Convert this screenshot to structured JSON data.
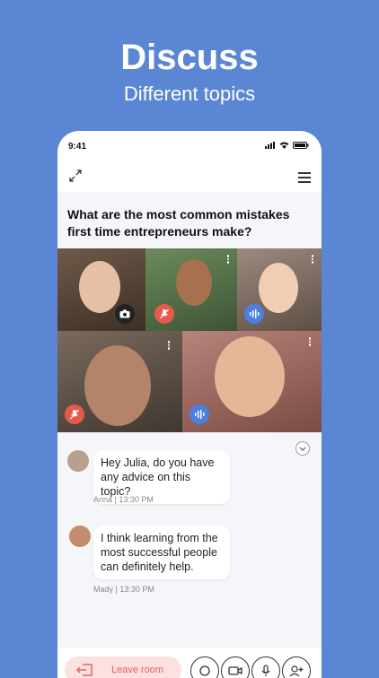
{
  "hero": {
    "title": "Discuss",
    "subtitle": "Different topics"
  },
  "status": {
    "time": "9:41"
  },
  "room": {
    "question": "What are the most common mistakes first time entrepreneurs make?"
  },
  "messages": [
    {
      "text": "Hey Julia, do you have any advice on this topic?",
      "author": "Anna",
      "time": "13:30 PM"
    },
    {
      "text": "I think learning from the most successful people can definitely help.",
      "author": "Mady",
      "time": "13:30 PM"
    }
  ],
  "actions": {
    "leave_label": "Leave room"
  },
  "colors": {
    "background": "#5b86d4",
    "mute": "#e55a4a",
    "talking": "#4d7fe0",
    "leave_bg": "#fde0e0"
  }
}
